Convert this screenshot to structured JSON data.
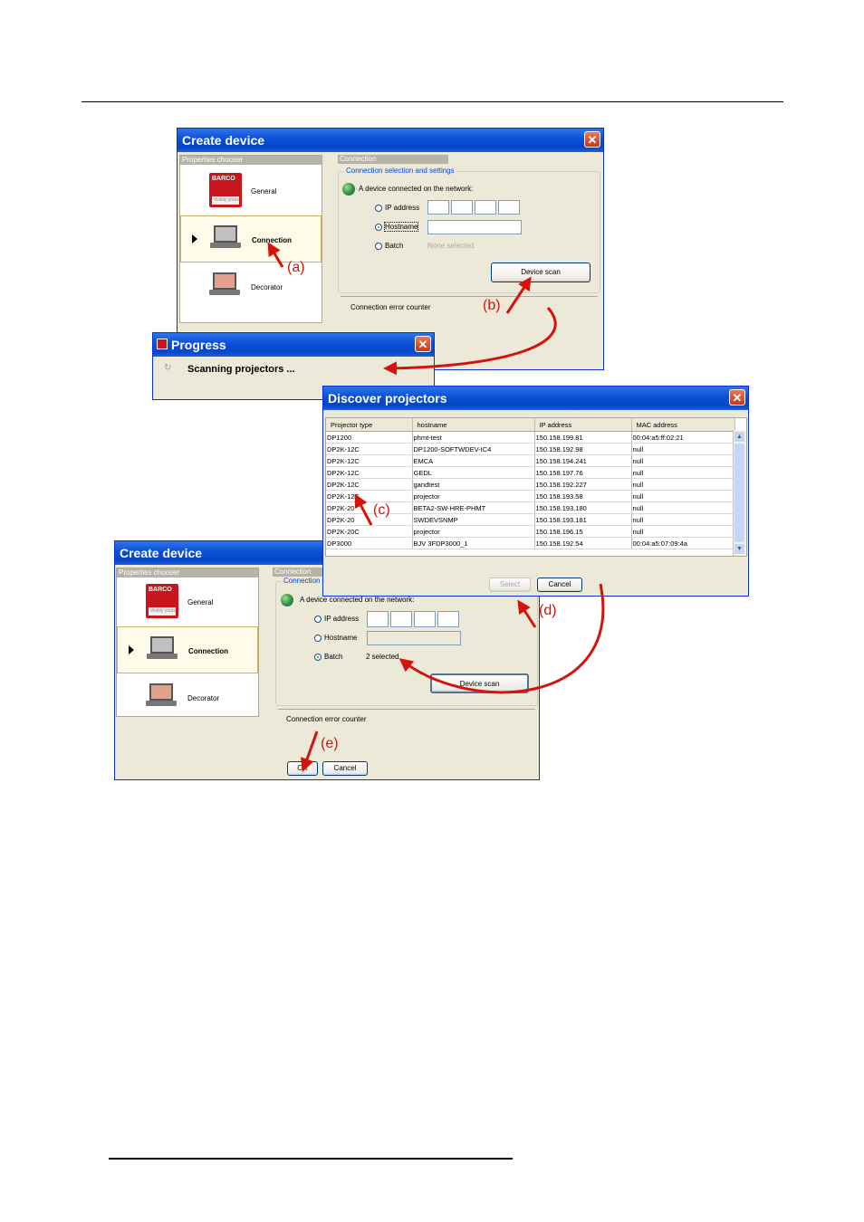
{
  "dlg1": {
    "title": "Create device",
    "chooser_header": "Properties chooser",
    "conn_header": "Connection",
    "items": [
      {
        "label": "General",
        "logo_text": "BARCO",
        "logo_sub": "Visibly yours"
      },
      {
        "label": "Connection"
      },
      {
        "label": "Decorator"
      }
    ],
    "group_label": "Connection selection and settings",
    "network_label": "A device connected on the network:",
    "ip_label": "IP address",
    "hostname_label": "Hostname",
    "batch_label": "Batch",
    "batch_value": "None selected",
    "scan_button": "Device scan",
    "error_counter": "Connection error counter"
  },
  "progress": {
    "title": "Progress",
    "message": "Scanning projectors ..."
  },
  "discover": {
    "title": "Discover projectors",
    "columns": [
      "Projector type",
      "hostname",
      "IP address",
      "MAC address"
    ],
    "rows": [
      [
        "DP1200",
        "phmt-test",
        "150.158.199.81",
        "00:04:a5:ff:02:21"
      ],
      [
        "DP2K-12C",
        "DP1200-SOFTWDEV-IC4",
        "150.158.192.98",
        "null"
      ],
      [
        "DP2K-12C",
        "EMCA",
        "150.158.194.241",
        "null"
      ],
      [
        "DP2K-12C",
        "GEDL",
        "150.158.197.76",
        "null"
      ],
      [
        "DP2K-12C",
        "gandtest",
        "150.158.192.227",
        "null"
      ],
      [
        "DP2K-12C",
        "projector",
        "150.158.193.58",
        "null"
      ],
      [
        "DP2K-20",
        "BETA2-SW-HRE-PHMT",
        "150.158.193.180",
        "null"
      ],
      [
        "DP2K-20",
        "SWDEVSNMP",
        "150.158.193.181",
        "null"
      ],
      [
        "DP2K-20C",
        "projector",
        "150.158.196.15",
        "null"
      ],
      [
        "DP3000",
        "BJV 3FDP3000_1",
        "150.158.192.54",
        "00:04:a5:07:09:4a"
      ]
    ],
    "select_button": "Select",
    "cancel_button": "Cancel"
  },
  "dlg2": {
    "title": "Create device",
    "chooser_header": "Properties chooser",
    "conn_header": "Connection",
    "group_label": "Connection s",
    "items": [
      {
        "label": "General",
        "logo_text": "BARCO",
        "logo_sub": "Visibly yours"
      },
      {
        "label": "Connection"
      },
      {
        "label": "Decorator"
      }
    ],
    "network_label": "A device connected on the network:",
    "ip_label": "IP address",
    "hostname_label": "Hostname",
    "batch_label": "Batch",
    "batch_value": "2 selected",
    "scan_button": "Device scan",
    "error_counter": "Connection error counter",
    "ok_button": "OK",
    "cancel_button": "Cancel"
  },
  "annotations": {
    "a": "(a)",
    "b": "(b)",
    "c": "(c)",
    "d": "(d)",
    "e": "(e)"
  },
  "colors": {
    "annotation": "#d4140c",
    "titlebar": "#0a4fd6",
    "dialog_bg": "#ece9d8",
    "legend": "#0046d5"
  }
}
